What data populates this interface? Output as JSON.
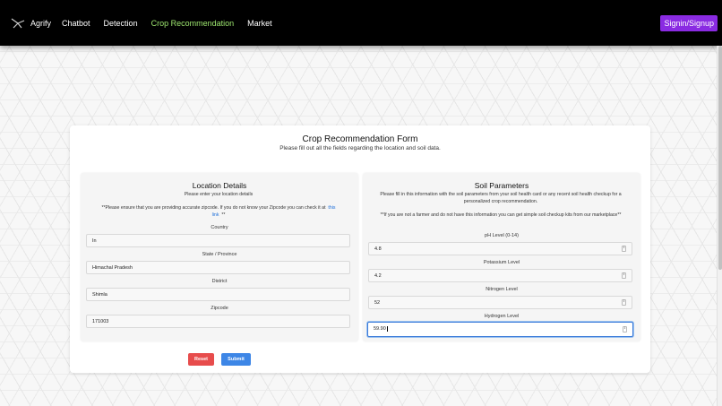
{
  "nav": {
    "brand": "Agrify",
    "links": [
      "Chatbot",
      "Detection",
      "Crop Recommendation",
      "Market"
    ],
    "signin": "Signin/Signup"
  },
  "form": {
    "title": "Crop Recommendation Form",
    "subtitle": "Please fill out all the fields regarding the location and soil data.",
    "reset_label": "Reset",
    "submit_label": "Submit"
  },
  "location": {
    "title": "Location Details",
    "subtitle": "Please enter your location details",
    "note": "**Please ensure that you are providing accurate zipcode. If you do not know your Zipcode you can check it at",
    "link": "this link",
    "note_end": "**",
    "fields": [
      {
        "label": "Country",
        "value": "In"
      },
      {
        "label": "State / Province",
        "value": "Himachal Pradesh"
      },
      {
        "label": "District",
        "value": "Shimla"
      },
      {
        "label": "Zipcode",
        "value": "171003"
      }
    ]
  },
  "soil": {
    "title": "Soil Parameters",
    "subtitle": "Please fill in this information with the soil parameters from your soil health card or any recent soil health checkup for a personalized crop recommendation.",
    "note": "**If you are not a farmer and do not have this information you can get simple soil checkup kits from our marketplace**",
    "fields": [
      {
        "label": "pH Level (0-14)",
        "value": "4.8"
      },
      {
        "label": "Potassium Level",
        "value": "4.2"
      },
      {
        "label": "Nitrogen Level",
        "value": "52"
      },
      {
        "label": "Hydrogen Level",
        "value": "59.90"
      }
    ]
  },
  "colors": {
    "nav_bg": "#000000",
    "active_link": "#9fe870",
    "signin_bg": "#8a2be2",
    "reset_bg": "#e74c4c",
    "submit_bg": "#3d86e6"
  }
}
